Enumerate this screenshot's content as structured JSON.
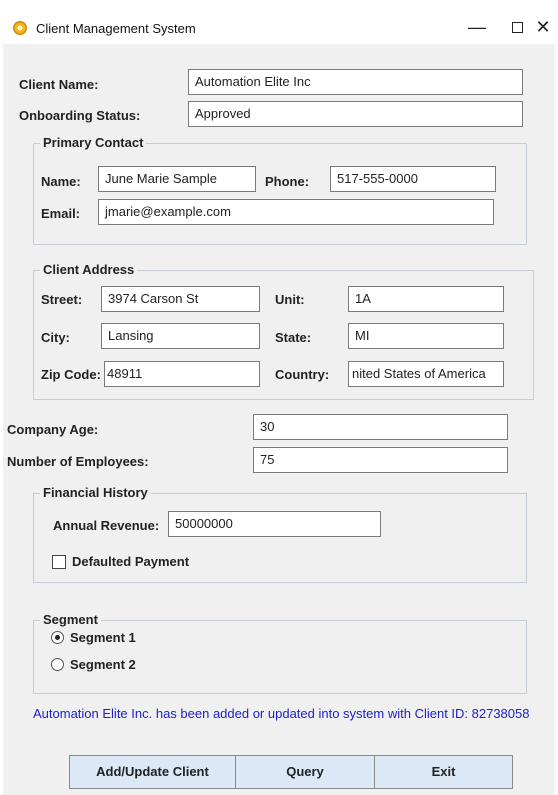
{
  "window": {
    "title": "Client Management System",
    "controls": {
      "minimize": "—",
      "close": "✕"
    }
  },
  "client": {
    "name_label": "Client Name:",
    "name_value": "Automation Elite Inc",
    "status_label": "Onboarding Status:",
    "status_value": "Approved"
  },
  "primary_contact": {
    "title": "Primary Contact",
    "name_label": "Name:",
    "name_value": "June Marie Sample",
    "phone_label": "Phone:",
    "phone_value": "517-555-0000",
    "email_label": "Email:",
    "email_value": "jmarie@example.com"
  },
  "address": {
    "title": "Client Address",
    "street_label": "Street:",
    "street_value": "3974 Carson St",
    "unit_label": "Unit:",
    "unit_value": "1A",
    "city_label": "City:",
    "city_value": "Lansing",
    "state_label": "State:",
    "state_value": "MI",
    "zip_label": "Zip Code:",
    "zip_value": "48911",
    "country_label": "Country:",
    "country_value": "nited States of America"
  },
  "company": {
    "age_label": "Company Age:",
    "age_value": "30",
    "employees_label": "Number of Employees:",
    "employees_value": "75"
  },
  "financial": {
    "title": "Financial History",
    "revenue_label": "Annual Revenue:",
    "revenue_value": "50000000",
    "defaulted_label": "Defaulted Payment",
    "defaulted_checked": false
  },
  "segment": {
    "title": "Segment",
    "options": [
      "Segment 1",
      "Segment 2"
    ],
    "selected": "Segment 1"
  },
  "status_message": "Automation Elite Inc. has been added or updated into system with Client ID: 82738058",
  "buttons": {
    "add_update": "Add/Update Client",
    "query": "Query",
    "exit": "Exit"
  },
  "colors": {
    "window_bg": "#f0f0f0",
    "message_text": "#2020c8",
    "button_bg": "#dbe9f7",
    "group_border": "#c5ccd6"
  }
}
